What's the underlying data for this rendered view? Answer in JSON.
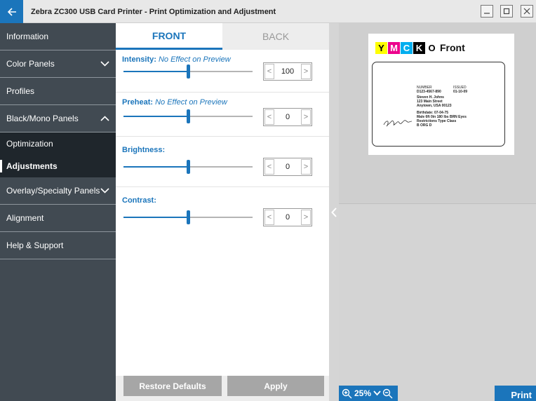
{
  "window": {
    "title": "Zebra ZC300 USB Card Printer - Print Optimization and Adjustment",
    "icons": {
      "back": "arrow-left-icon",
      "minimize": "minimize-icon",
      "maximize": "maximize-icon",
      "close": "close-icon"
    }
  },
  "sidebar": {
    "items": [
      {
        "label": "Information",
        "expandable": false
      },
      {
        "label": "Color Panels",
        "expandable": true,
        "expanded": false
      },
      {
        "label": "Profiles",
        "expandable": false
      },
      {
        "label": "Black/Mono Panels",
        "expandable": true,
        "expanded": true
      },
      {
        "label": "Overlay/Specialty Panels",
        "expandable": true,
        "expanded": false
      },
      {
        "label": "Alignment",
        "expandable": false
      },
      {
        "label": "Help & Support",
        "expandable": false
      }
    ],
    "subitems": [
      {
        "label": "Optimization",
        "active": false
      },
      {
        "label": "Adjustments",
        "active": true
      }
    ]
  },
  "tabs": {
    "front": "FRONT",
    "back": "BACK",
    "selected": "front"
  },
  "adjustments": [
    {
      "label": "Intensity:",
      "note": "No Effect on Preview",
      "value": "100",
      "slider_fraction": 0.5
    },
    {
      "label": "Preheat:",
      "note": "No Effect on Preview",
      "value": "0",
      "slider_fraction": 0.5
    },
    {
      "label": "Brightness:",
      "note": "",
      "value": "0",
      "slider_fraction": 0.5
    },
    {
      "label": "Contrast:",
      "note": "",
      "value": "0",
      "slider_fraction": 0.5
    }
  ],
  "buttons": {
    "restore": "Restore Defaults",
    "apply": "Apply"
  },
  "preview": {
    "panels": [
      {
        "letter": "Y",
        "bg": "#ffff00",
        "fg": "#000000"
      },
      {
        "letter": "M",
        "bg": "#ec008c",
        "fg": "#ffffff"
      },
      {
        "letter": "C",
        "bg": "#00aeef",
        "fg": "#ffffff"
      },
      {
        "letter": "K",
        "bg": "#000000",
        "fg": "#ffffff"
      },
      {
        "letter": "O",
        "bg": "#ffffff",
        "fg": "#000000"
      }
    ],
    "side": "Front",
    "card": {
      "number_label": "NUMBER",
      "issued_label": "ISSUED",
      "number": "D123-4567-890",
      "issued": "01-10-09",
      "name": "Steven H. Johns",
      "street": "123 Main Street",
      "city": "Anytown, USA 00123",
      "birthdate": "Birthdate: 07-04-75",
      "stats": "Male      6ft 0in      180 lbs    BRN Eyes",
      "restrictions": "Restrictions    Type      Class",
      "restrict_values": "B                 ORG        D"
    },
    "zoom": "25%",
    "print": "Print"
  },
  "colors": {
    "accent": "#1b75bb",
    "sidebar": "#414a52",
    "sidebar_sub": "#1f262c",
    "button_disabled": "#a6a6a6"
  }
}
